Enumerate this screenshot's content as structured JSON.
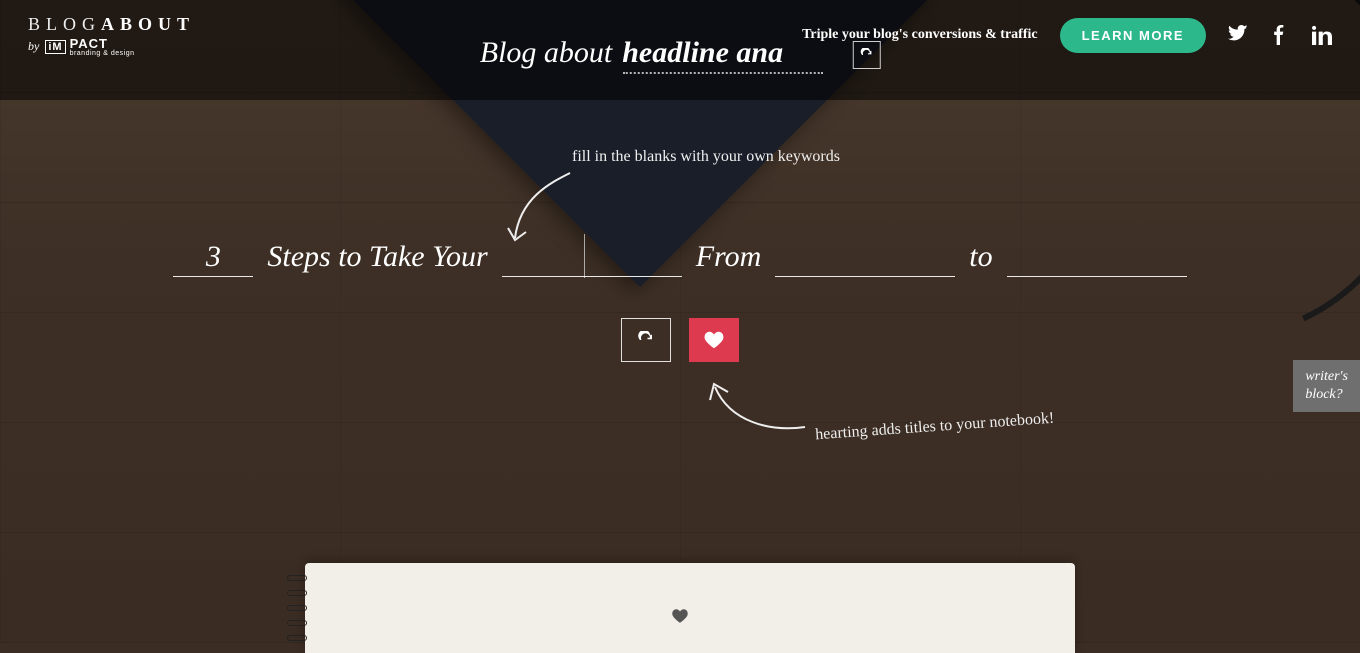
{
  "header": {
    "logo_part1": "BLOG",
    "logo_part2": "ABOUT",
    "by_text": "by",
    "impact_brand": "PACT",
    "impact_tagline": "branding & design",
    "promo_text": "Triple your blog's conversions & traffic",
    "learn_more_label": "LEARN MORE"
  },
  "hero": {
    "prefix": "Blog about",
    "topic_value": "headline ana"
  },
  "hints": {
    "fill_blanks": "fill in the blanks with your own keywords",
    "hearting": "hearting adds titles to your notebook!"
  },
  "headline_template": {
    "num_value": "3",
    "part1": "Steps to Take Your",
    "blank1_value": "",
    "part2": "From",
    "blank2_value": "",
    "part3": "to",
    "blank3_value": ""
  },
  "sidebar": {
    "writers_block_line1": "writer's",
    "writers_block_line2": "block?"
  },
  "colors": {
    "accent_green": "#2db88b",
    "accent_red": "#de3a4f"
  }
}
